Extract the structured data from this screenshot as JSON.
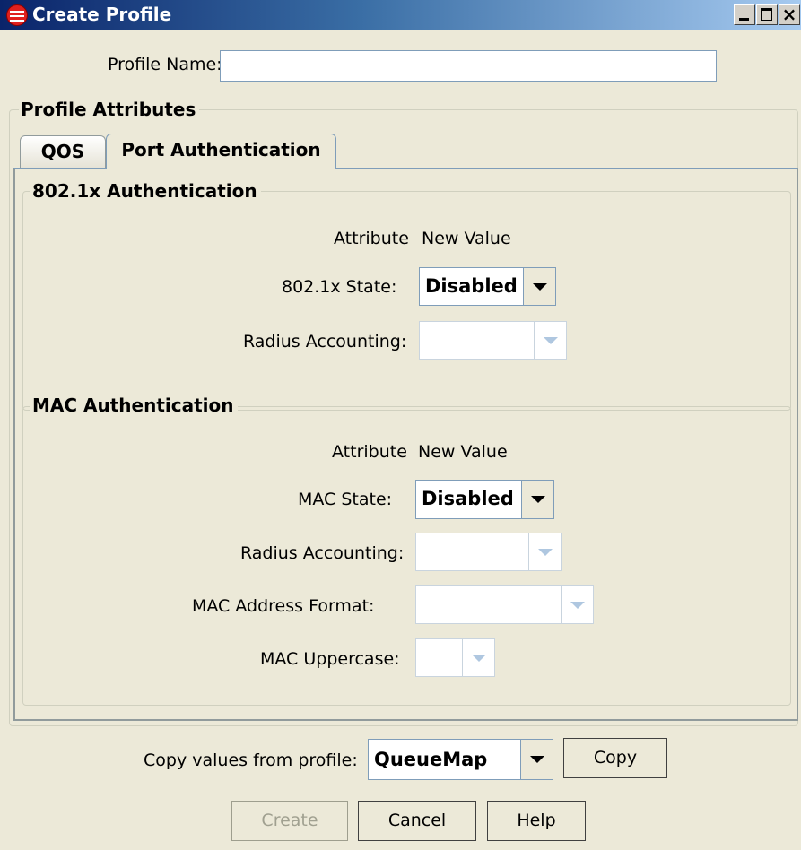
{
  "window": {
    "title": "Create Profile",
    "controls": {
      "minimize": "minimize-icon",
      "maximize": "maximize-icon",
      "close": "×"
    }
  },
  "profile_name": {
    "label": "Profile Name:",
    "value": ""
  },
  "profile_attributes": {
    "title": "Profile Attributes",
    "tabs": [
      {
        "label": "QOS",
        "selected": false
      },
      {
        "label": "Port Authentication",
        "selected": true
      }
    ]
  },
  "dot1x": {
    "title": "802.1x Authentication",
    "attribute_header": "Attribute",
    "value_header": "New Value",
    "state_label": "802.1x State:",
    "state_value": "Disabled",
    "radius_label": "Radius Accounting:",
    "radius_value": ""
  },
  "mac": {
    "title": "MAC Authentication",
    "attribute_header": "Attribute",
    "value_header": "New Value",
    "state_label": "MAC State:",
    "state_value": "Disabled",
    "radius_label": "Radius Accounting:",
    "radius_value": "",
    "address_format_label": "MAC Address Format:",
    "address_format_value": "",
    "uppercase_label": "MAC Uppercase:",
    "uppercase_value": ""
  },
  "copy": {
    "label": "Copy values from profile:",
    "selected_profile": "QueueMap",
    "button": "Copy"
  },
  "buttons": {
    "create": "Create",
    "cancel": "Cancel",
    "help": "Help"
  },
  "colors": {
    "window_background": "#ECE9D8",
    "title_gradient_start": "#0A246A",
    "title_gradient_end": "#A6CAF0",
    "control_border": "#7F9DB9"
  }
}
